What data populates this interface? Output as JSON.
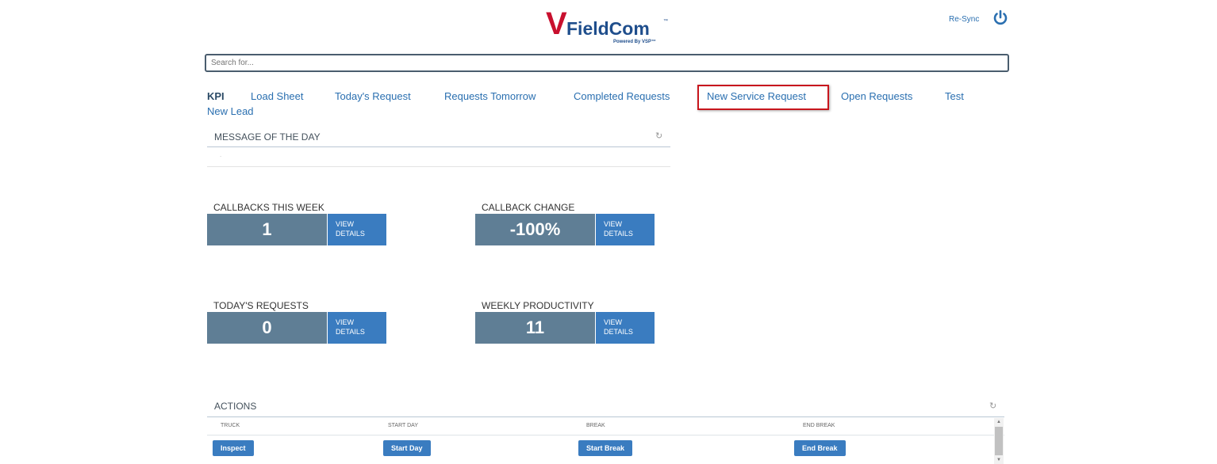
{
  "header": {
    "logo": {
      "v": "V",
      "name": "FieldCom",
      "tagline": "Powered By VSP™",
      "tm": "™"
    },
    "resync_label": "Re-Sync",
    "power_icon": "power-icon"
  },
  "search": {
    "placeholder": "Search for..."
  },
  "nav": {
    "items": [
      {
        "label": "KPI",
        "active": true
      },
      {
        "label": "Load Sheet"
      },
      {
        "label": "Today's Request"
      },
      {
        "label": "Requests Tomorrow"
      },
      {
        "label": "Completed Requests"
      },
      {
        "label": "New Service Request",
        "highlighted": true
      },
      {
        "label": "Open Requests"
      },
      {
        "label": "Test"
      },
      {
        "label": "New Lead"
      }
    ]
  },
  "motd": {
    "title": "MESSAGE OF THE DAY",
    "body": ".",
    "refresh_icon": "refresh-icon"
  },
  "kpis": [
    {
      "label": "CALLBACKS THIS WEEK",
      "value": "1",
      "details_line1": "VIEW",
      "details_line2": "DETAILS"
    },
    {
      "label": "CALLBACK CHANGE",
      "value": "-100%",
      "details_line1": "VIEW",
      "details_line2": "DETAILS"
    },
    {
      "label": "TODAY'S REQUESTS",
      "value": "0",
      "details_line1": "VIEW",
      "details_line2": "DETAILS"
    },
    {
      "label": "WEEKLY PRODUCTIVITY",
      "value": "11",
      "details_line1": "VIEW",
      "details_line2": "DETAILS"
    }
  ],
  "actions": {
    "title": "ACTIONS",
    "columns": [
      "TRUCK",
      "START DAY",
      "BREAK",
      "END BREAK"
    ],
    "buttons": [
      "Inspect",
      "Start Day",
      "Start Break",
      "End Break"
    ]
  },
  "colors": {
    "accent": "#3a7cc0",
    "kpi_value_bg": "#5f7e95",
    "highlight_border": "#c8161d",
    "brand_red": "#c8102e",
    "brand_blue": "#1f4e8c"
  }
}
